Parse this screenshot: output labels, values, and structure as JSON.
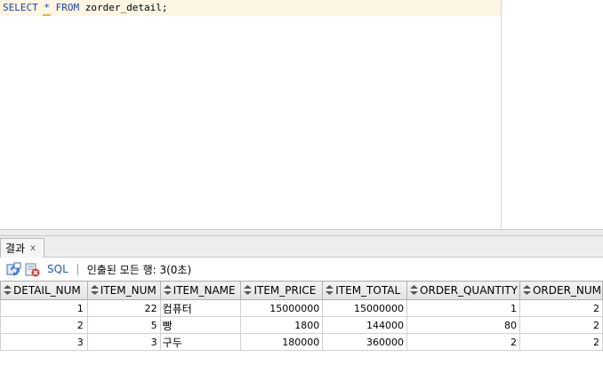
{
  "editor": {
    "sql_keyword_select": "SELECT",
    "sql_star": "*",
    "sql_keyword_from": "FROM",
    "sql_rest": "zorder_detail;"
  },
  "results": {
    "tab_label": "결과",
    "tab_close": "x",
    "toolbar": {
      "sql_label": "SQL",
      "status_text": "인출된 모든 행: 3(0초)"
    },
    "columns": [
      "DETAIL_NUM",
      "ITEM_NUM",
      "ITEM_NAME",
      "ITEM_PRICE",
      "ITEM_TOTAL",
      "ORDER_QUANTITY",
      "ORDER_NUM"
    ],
    "rows": [
      {
        "rownum": "1",
        "detail_num": "22",
        "item_name": "컴퓨터",
        "item_price": "15000000",
        "item_total": "15000000",
        "order_quantity": "1",
        "order_num": "2"
      },
      {
        "rownum": "2",
        "detail_num": "5",
        "item_name": "빵",
        "item_price": "1800",
        "item_total": "144000",
        "order_quantity": "80",
        "order_num": "2"
      },
      {
        "rownum": "3",
        "detail_num": "3",
        "item_name": "구두",
        "item_price": "180000",
        "item_total": "360000",
        "order_quantity": "2",
        "order_num": "2"
      }
    ]
  },
  "colors": {
    "keyword": "#1f3fa6",
    "current_line": "#fdf6e3",
    "link": "#1f5fb0"
  },
  "icons": [
    "refresh-icon",
    "delete-icon",
    "column-header-icon"
  ]
}
